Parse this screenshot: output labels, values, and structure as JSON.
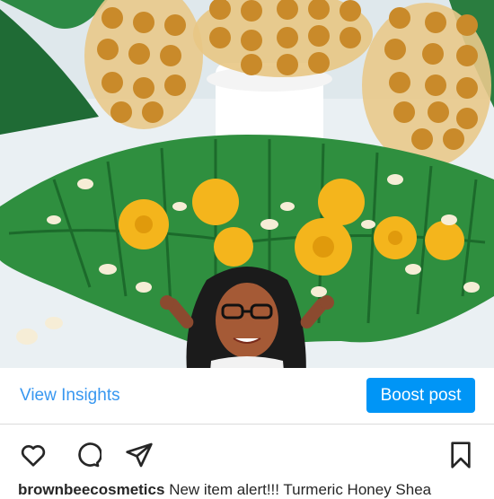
{
  "post": {
    "image_alt": "Turmeric honey shea soap bars on leaves with yellow flowers",
    "insights_label": "View Insights",
    "boost_label": "Boost post",
    "caption_user": "brownbeecosmetics",
    "caption_text": "New item alert!!! Turmeric Honey Shea"
  },
  "icons": {
    "like": "heart-icon",
    "comment": "comment-icon",
    "share": "send-icon",
    "save": "bookmark-icon"
  },
  "colors": {
    "link_blue": "#3897f0",
    "boost_blue": "#0095f6",
    "text": "#262626"
  }
}
